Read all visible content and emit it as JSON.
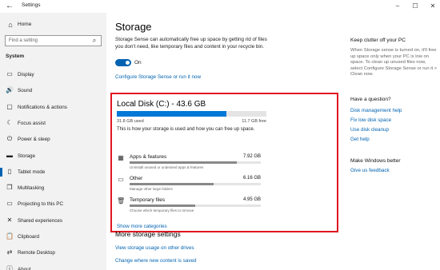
{
  "window": {
    "back_icon": "back-arrow-icon",
    "title": "Settings",
    "controls": {
      "minimize": "–",
      "maximize": "☐",
      "close": "✕"
    }
  },
  "sidebar": {
    "home_label": "Home",
    "search_placeholder": "Find a setting",
    "section_label": "System",
    "active_index": 6,
    "items": [
      {
        "label": "Display",
        "icon": "display-icon",
        "glyph": "▭"
      },
      {
        "label": "Sound",
        "icon": "sound-icon",
        "glyph": "🔊"
      },
      {
        "label": "Notifications & actions",
        "icon": "notifications-icon",
        "glyph": "▢"
      },
      {
        "label": "Focus assist",
        "icon": "focus-assist-icon",
        "glyph": "☾"
      },
      {
        "label": "Power & sleep",
        "icon": "power-icon",
        "glyph": "⏻"
      },
      {
        "label": "Storage",
        "icon": "storage-icon",
        "glyph": "▬"
      },
      {
        "label": "Tablet mode",
        "icon": "tablet-mode-icon",
        "glyph": "▯"
      },
      {
        "label": "Multitasking",
        "icon": "multitasking-icon",
        "glyph": "❐"
      },
      {
        "label": "Projecting to this PC",
        "icon": "projecting-icon",
        "glyph": "▭"
      },
      {
        "label": "Shared experiences",
        "icon": "shared-experiences-icon",
        "glyph": "✕"
      },
      {
        "label": "Clipboard",
        "icon": "clipboard-icon",
        "glyph": "📋"
      },
      {
        "label": "Remote Desktop",
        "icon": "remote-desktop-icon",
        "glyph": "⇄"
      },
      {
        "label": "About",
        "icon": "about-icon",
        "glyph": "ⓘ"
      }
    ]
  },
  "main": {
    "title": "Storage",
    "sense_description": "Storage Sense can automatically free up space by getting rid of files you don't need, like temporary files and content in your recycle bin.",
    "toggle_state": "On",
    "configure_link": "Configure Storage Sense or run it now",
    "disk": {
      "title": "Local Disk (C:) - 43.6 GB",
      "used": "31.8 GB used",
      "free": "11.7 GB free",
      "used_fraction": 0.73,
      "description": "This is how your storage is used and how you can free up space.",
      "categories": [
        {
          "name": "Apps & features",
          "size": "7.92 GB",
          "sub": "Uninstall unused or undesired apps & features",
          "fraction": 0.82,
          "icon": "apps-features-icon",
          "glyph": "▦"
        },
        {
          "name": "Other",
          "size": "6.16 GB",
          "sub": "Manage other large folders",
          "fraction": 0.64,
          "icon": "other-folder-icon",
          "glyph": "▭"
        },
        {
          "name": "Temporary files",
          "size": "4.95 GB",
          "sub": "Choose which temporary files to remove",
          "fraction": 0.5,
          "icon": "trash-icon",
          "glyph": "🗑"
        }
      ],
      "show_more": "Show more categories"
    },
    "more_settings": {
      "title": "More storage settings",
      "links": [
        "View storage usage on other drives",
        "Change where new content is saved"
      ]
    }
  },
  "right_panel": {
    "tip_title": "Keep clutter off your PC",
    "tip_text": "When Storage sense is turned on, it'll free up space only when your PC is low on space. To clean up unused files now, select Configure Storage Sense or run it > Clean now.",
    "question_title": "Have a question?",
    "question_links": [
      "Disk management help",
      "Fix low disk space",
      "Use disk cleanup",
      "Get help"
    ],
    "better_title": "Make Windows better",
    "better_link": "Give us feedback"
  },
  "colors": {
    "accent": "#0063b1",
    "highlight_box": "#e0161f",
    "sidebar_bg": "#f2f2f2"
  }
}
